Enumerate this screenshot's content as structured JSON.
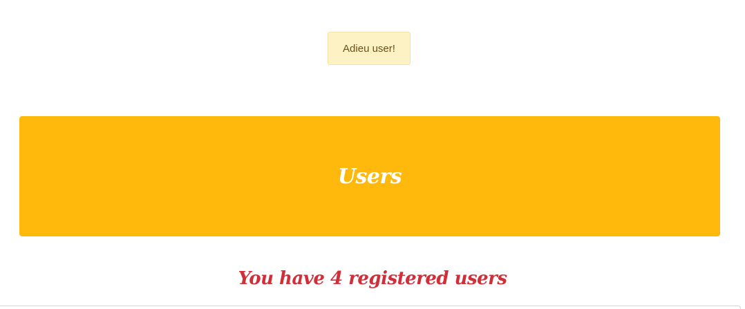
{
  "flash": {
    "message": "Adieu user!"
  },
  "hero": {
    "title": "Users"
  },
  "summary": {
    "text": "You have 4 registered users"
  },
  "colors": {
    "hero_background": "#ffb90c",
    "flash_background": "#fcf2c4",
    "summary_text": "#d02f3a"
  }
}
